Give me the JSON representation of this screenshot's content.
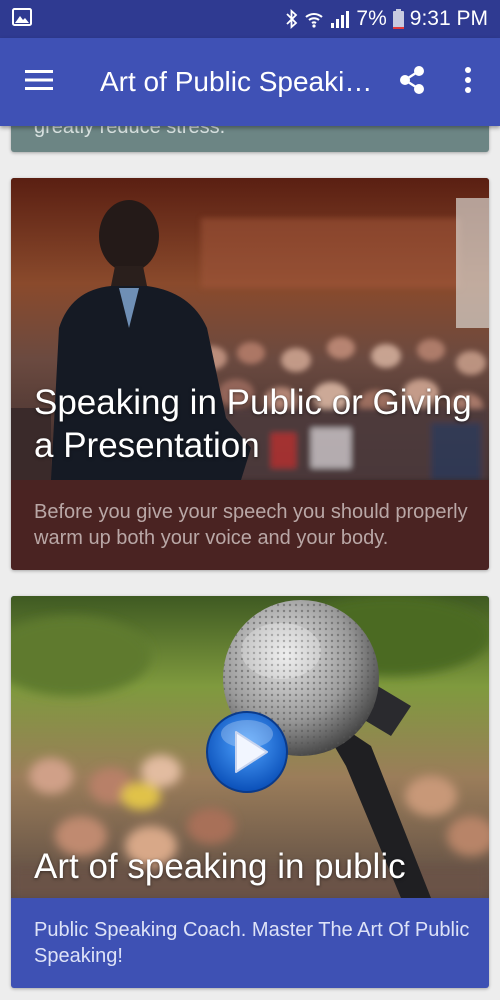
{
  "status_bar": {
    "battery": "7%",
    "time": "9:31 PM",
    "icons": [
      "image-notification-icon",
      "bluetooth-icon",
      "wifi-icon",
      "signal-icon",
      "battery-icon"
    ]
  },
  "app_bar": {
    "title": "Art of Public Speaking",
    "color": "#3f51b5",
    "icons": [
      "menu-icon",
      "share-icon",
      "more-vert-icon"
    ]
  },
  "cards": [
    {
      "description": "greatly reduce stress."
    },
    {
      "title": "Speaking in Public or Giving a Presentation",
      "description": "Before you give your speech you should properly warm up both your voice and your body.",
      "color": "#4a2322"
    },
    {
      "title": "Art of speaking in public",
      "description": "Public Speaking Coach. Master The Art Of Public Speaking!",
      "color": "#3e51b4",
      "media_icon": "play-icon"
    }
  ]
}
